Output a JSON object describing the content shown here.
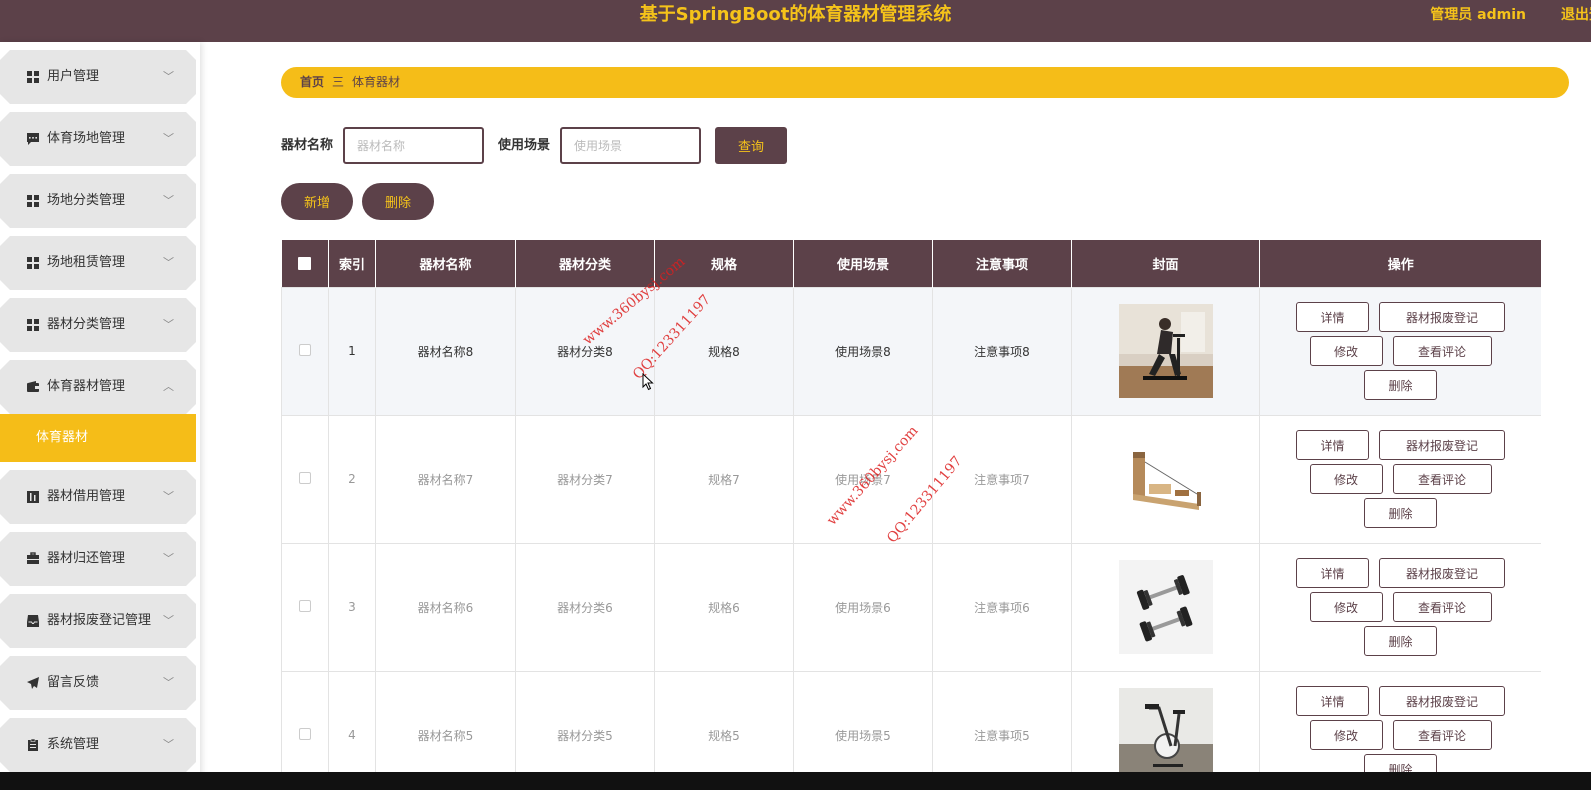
{
  "header": {
    "title": "基于SpringBoot的体育器材管理系统",
    "user": "管理员 admin",
    "logout": "退出登"
  },
  "sidebar": {
    "items": [
      {
        "label": "用户管理",
        "icon": "grid-icon",
        "expanded": false
      },
      {
        "label": "体育场地管理",
        "icon": "chat-icon",
        "expanded": false
      },
      {
        "label": "场地分类管理",
        "icon": "grid-icon",
        "expanded": false
      },
      {
        "label": "场地租赁管理",
        "icon": "grid-icon",
        "expanded": false
      },
      {
        "label": "器材分类管理",
        "icon": "grid-icon",
        "expanded": false
      },
      {
        "label": "体育器材管理",
        "icon": "wallet-icon",
        "expanded": true
      },
      {
        "label": "器材借用管理",
        "icon": "chart-icon",
        "expanded": false
      },
      {
        "label": "器材归还管理",
        "icon": "briefcase-icon",
        "expanded": false
      },
      {
        "label": "器材报废登记管理",
        "icon": "inbox-icon",
        "expanded": false
      },
      {
        "label": "留言反馈",
        "icon": "send-icon",
        "expanded": false
      },
      {
        "label": "系统管理",
        "icon": "clipboard-icon",
        "expanded": false
      }
    ],
    "active_sub": "体育器材"
  },
  "breadcrumb": {
    "home": "首页",
    "separator": "三",
    "current": "体育器材"
  },
  "search": {
    "name_label": "器材名称",
    "name_placeholder": "器材名称",
    "scene_label": "使用场景",
    "scene_placeholder": "使用场景",
    "query_label": "查询"
  },
  "actions": {
    "add_label": "新增",
    "delete_label": "删除"
  },
  "table": {
    "columns": [
      "索引",
      "器材名称",
      "器材分类",
      "规格",
      "使用场景",
      "注意事项",
      "封面",
      "操作"
    ],
    "rows": [
      {
        "index": "1",
        "name": "器材名称8",
        "category": "器材分类8",
        "spec": "规格8",
        "scene": "使用场景8",
        "notes": "注意事项8",
        "cover": "exercise-bike-photo"
      },
      {
        "index": "2",
        "name": "器材名称7",
        "category": "器材分类7",
        "spec": "规格7",
        "scene": "使用场景7",
        "notes": "注意事项7",
        "cover": "pilates-reformer-photo"
      },
      {
        "index": "3",
        "name": "器材名称6",
        "category": "器材分类6",
        "spec": "规格6",
        "scene": "使用场景6",
        "notes": "注意事项6",
        "cover": "dumbbells-photo"
      },
      {
        "index": "4",
        "name": "器材名称5",
        "category": "器材分类5",
        "spec": "规格5",
        "scene": "使用场景5",
        "notes": "注意事项5",
        "cover": "spin-bike-photo"
      }
    ],
    "row_actions": {
      "detail": "详情",
      "scrap": "器材报废登记",
      "edit": "修改",
      "reviews": "查看评论",
      "delete": "删除"
    }
  },
  "watermarks": [
    {
      "text": "www.360bysj.com"
    },
    {
      "text": "QQ:123311197"
    },
    {
      "text": "www.360bysj.com"
    },
    {
      "text": "QQ:123311197"
    }
  ],
  "colors": {
    "primary": "#5c4149",
    "accent": "#f5bd18",
    "title": "#f5c31a"
  }
}
